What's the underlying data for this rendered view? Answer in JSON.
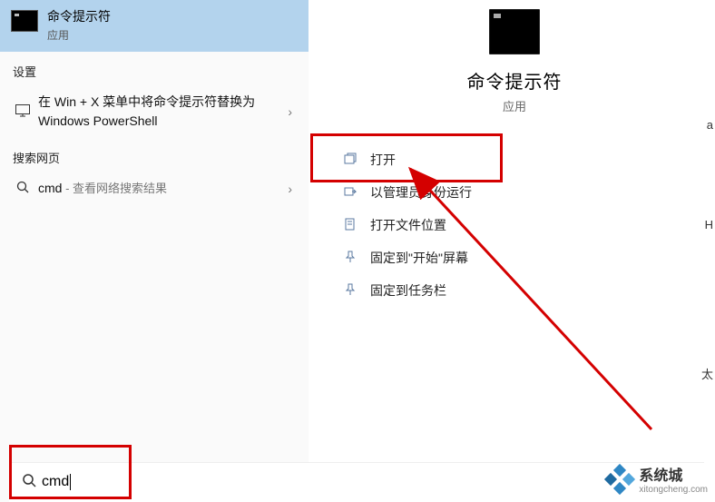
{
  "best_match": {
    "title": "命令提示符",
    "subtitle": "应用"
  },
  "settings": {
    "header": "设置",
    "item1": "在 Win + X 菜单中将命令提示符替换为 Windows PowerShell"
  },
  "web": {
    "header": "搜索网页",
    "query": "cmd",
    "suffix": " - 查看网络搜索结果"
  },
  "preview": {
    "name": "命令提示符",
    "type": "应用"
  },
  "actions": {
    "open": "打开",
    "run_admin": "以管理员身份运行",
    "open_location": "打开文件位置",
    "pin_start": "固定到\"开始\"屏幕",
    "pin_taskbar": "固定到任务栏"
  },
  "search": {
    "value": "cmd"
  },
  "watermark": {
    "line1": "系统城",
    "line2": "xitongcheng.com"
  },
  "edge_chars": {
    "a": "a",
    "b": "H",
    "c": "太"
  }
}
